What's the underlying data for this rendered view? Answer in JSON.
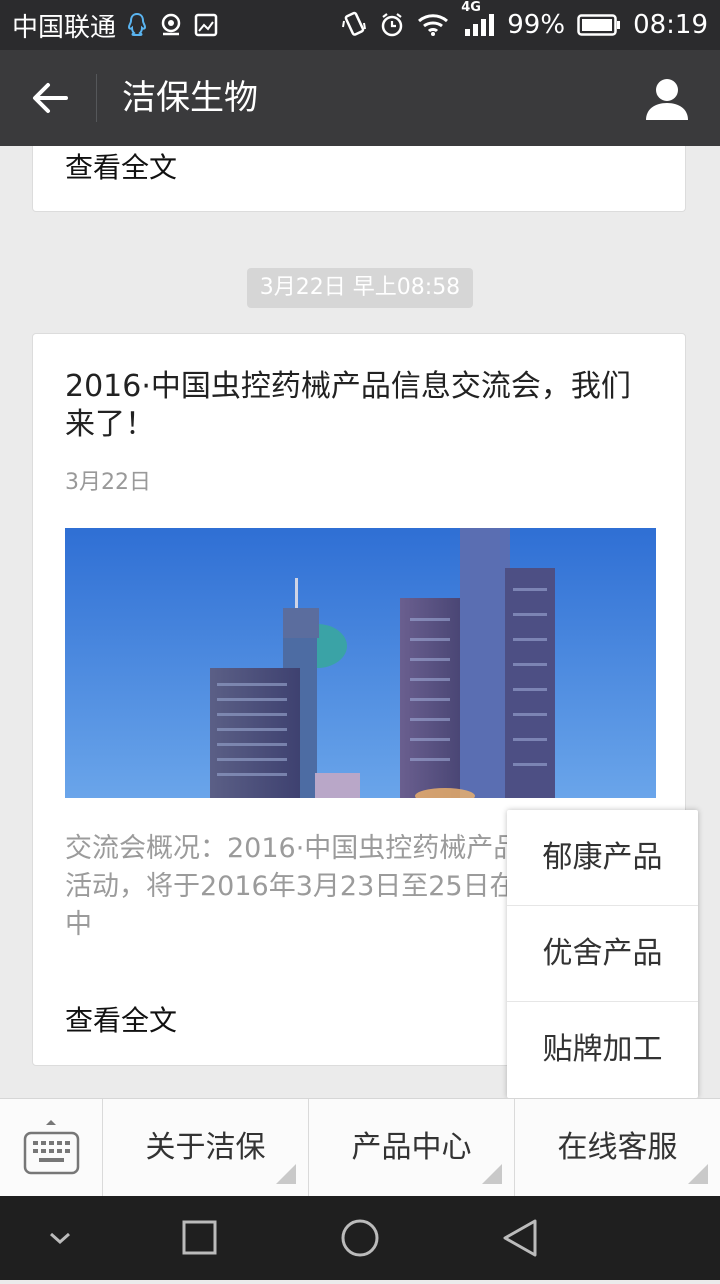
{
  "status_bar": {
    "carrier": "中国联通",
    "network": "4G",
    "battery": "99%",
    "time": "08:19"
  },
  "nav": {
    "title": "洁保生物"
  },
  "feed": {
    "prev_read_more": "查看全文",
    "timestamp": "3月22日 早上08:58",
    "article": {
      "title": "2016·中国虫控药械产品信息交流会，我们来了！",
      "date": "3月22日",
      "summary": "交流会概况：2016·中国虫控药械产品信息交流活动，将于2016年3月23日至25日在“马饭店”与中",
      "read_more": "查看全文"
    }
  },
  "popup_menu": {
    "items": [
      "郁康产品",
      "优舍产品",
      "贴牌加工"
    ]
  },
  "menu_bar": {
    "items": [
      "关于洁保",
      "产品中心",
      "在线客服"
    ]
  },
  "colors": {
    "nav_bg": "#3a3a3c",
    "status_bg": "#2b2b2d",
    "page_bg": "#ebebeb"
  }
}
